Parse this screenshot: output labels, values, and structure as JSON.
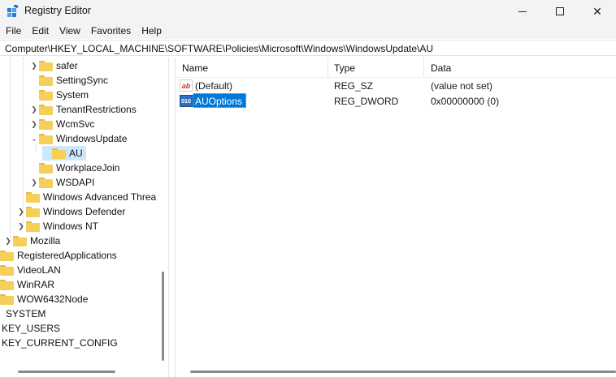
{
  "window": {
    "title": "Registry Editor",
    "icon": "registry-icon",
    "controls": {
      "minimize": "minimize-icon",
      "maximize": "maximize-icon",
      "close": "✕"
    }
  },
  "menu": [
    "File",
    "Edit",
    "View",
    "Favorites",
    "Help"
  ],
  "address": "Computer\\HKEY_LOCAL_MACHINE\\SOFTWARE\\Policies\\Microsoft\\Windows\\WindowsUpdate\\AU",
  "tree": [
    {
      "label": "safer",
      "expander": "collapsed"
    },
    {
      "label": "SettingSync",
      "expander": "none"
    },
    {
      "label": "System",
      "expander": "none"
    },
    {
      "label": "TenantRestrictions",
      "expander": "collapsed"
    },
    {
      "label": "WcmSvc",
      "expander": "collapsed"
    },
    {
      "label": "WindowsUpdate",
      "expander": "expanded"
    },
    {
      "label": "AU",
      "expander": "none",
      "selected": true
    },
    {
      "label": "WorkplaceJoin",
      "expander": "none"
    },
    {
      "label": "WSDAPI",
      "expander": "collapsed"
    },
    {
      "label": "Windows Advanced Threa",
      "expander": "none"
    },
    {
      "label": "Windows Defender",
      "expander": "collapsed"
    },
    {
      "label": "Windows NT",
      "expander": "collapsed"
    },
    {
      "label": "Mozilla",
      "expander": "collapsed"
    },
    {
      "label": "RegisteredApplications",
      "expander": "none"
    },
    {
      "label": "VideoLAN",
      "expander": "none"
    },
    {
      "label": "WinRAR",
      "expander": "none"
    },
    {
      "label": "WOW6432Node",
      "expander": "none"
    },
    {
      "label": "SYSTEM",
      "expander": "none"
    },
    {
      "label": "KEY_USERS",
      "expander": "none"
    },
    {
      "label": "KEY_CURRENT_CONFIG",
      "expander": "none"
    }
  ],
  "list": {
    "columns": [
      "Name",
      "Type",
      "Data"
    ],
    "rows": [
      {
        "icon": "ab",
        "name": "(Default)",
        "type": "REG_SZ",
        "data": "(value not set)",
        "selected": false
      },
      {
        "icon": "010",
        "name": "AUOptions",
        "type": "REG_DWORD",
        "data": "0x00000000 (0)",
        "selected": true
      }
    ]
  },
  "colors": {
    "selection": "#0078d7",
    "tree_selection": "#cce8ff",
    "folder": "#f6cf5b"
  }
}
